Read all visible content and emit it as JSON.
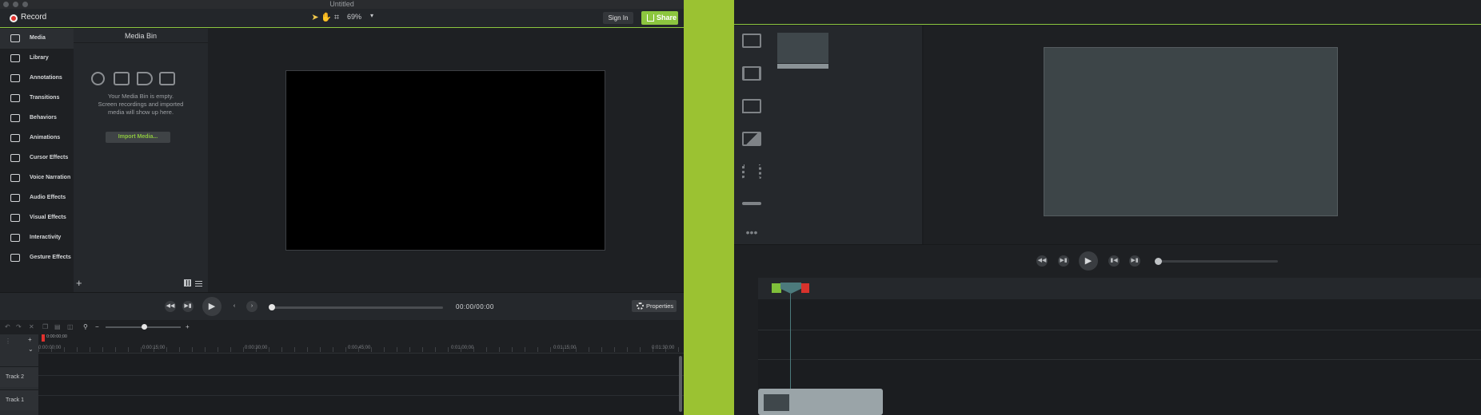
{
  "window": {
    "title": "Untitled"
  },
  "toolbar": {
    "record_label": "Record",
    "zoom_value": "69%",
    "signin_label": "Sign In",
    "share_label": "Share"
  },
  "sidebar": {
    "items": [
      {
        "label": "Media",
        "icon": "film-icon"
      },
      {
        "label": "Library",
        "icon": "library-icon"
      },
      {
        "label": "Annotations",
        "icon": "annotation-icon"
      },
      {
        "label": "Transitions",
        "icon": "transition-icon"
      },
      {
        "label": "Behaviors",
        "icon": "behaviors-icon"
      },
      {
        "label": "Animations",
        "icon": "animation-icon"
      },
      {
        "label": "Cursor Effects",
        "icon": "cursor-icon"
      },
      {
        "label": "Voice Narration",
        "icon": "microphone-icon"
      },
      {
        "label": "Audio Effects",
        "icon": "speaker-icon"
      },
      {
        "label": "Visual Effects",
        "icon": "wand-icon"
      },
      {
        "label": "Interactivity",
        "icon": "interactivity-icon"
      },
      {
        "label": "Gesture Effects",
        "icon": "hand-icon"
      }
    ]
  },
  "media_bin": {
    "title": "Media Bin",
    "empty_line1": "Your Media Bin is empty.",
    "empty_line2": "Screen recordings and imported",
    "empty_line3": "media will show up here.",
    "import_label": "Import Media..."
  },
  "playback": {
    "timecode": "00:00/00:00",
    "properties_label": "Properties",
    "progress": 0
  },
  "timeline": {
    "playhead_time": "0:00:00;00",
    "ticks": [
      "0:00:00;00",
      "0:00:15;00",
      "0:00:30;00",
      "0:00:45;00",
      "0:01:00;00",
      "0:01:15;00",
      "0:01:30;00"
    ],
    "tracks": [
      "Track 2",
      "Track 1"
    ]
  },
  "colors": {
    "accent": "#8cc63f",
    "record": "#e0312d",
    "gap": "#9bc232"
  }
}
